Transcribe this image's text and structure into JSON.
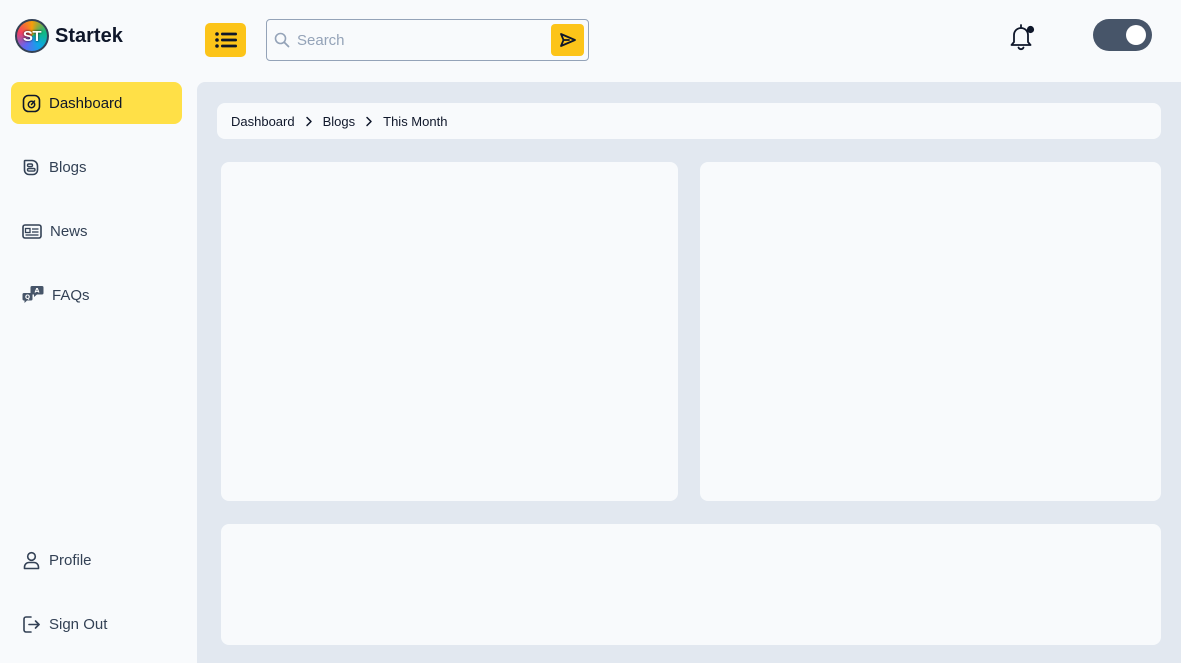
{
  "app": {
    "logo_initials": "ST",
    "name": "Startek"
  },
  "header": {
    "search_placeholder": "Search",
    "search_value": "",
    "menu_icon": "list-icon",
    "send_icon": "send-icon",
    "bell_icon": "bell-icon",
    "theme_toggle_on": true
  },
  "sidebar": {
    "items": [
      {
        "label": "Dashboard",
        "icon": "gauge-icon",
        "active": true
      },
      {
        "label": "Blogs",
        "icon": "blog-icon",
        "active": false
      },
      {
        "label": "News",
        "icon": "newspaper-icon",
        "active": false
      },
      {
        "label": "FAQs",
        "icon": "faq-icon",
        "active": false
      }
    ],
    "bottom": [
      {
        "label": "Profile",
        "icon": "user-icon"
      },
      {
        "label": "Sign Out",
        "icon": "sign-out-icon"
      }
    ]
  },
  "breadcrumb": [
    "Dashboard",
    "Blogs",
    "This Month"
  ],
  "colors": {
    "accent": "#fcc419",
    "active_nav": "#ffe047",
    "main_bg": "#e2e8f0",
    "card_bg": "#f8fafc",
    "toggle_bg": "#475569"
  }
}
